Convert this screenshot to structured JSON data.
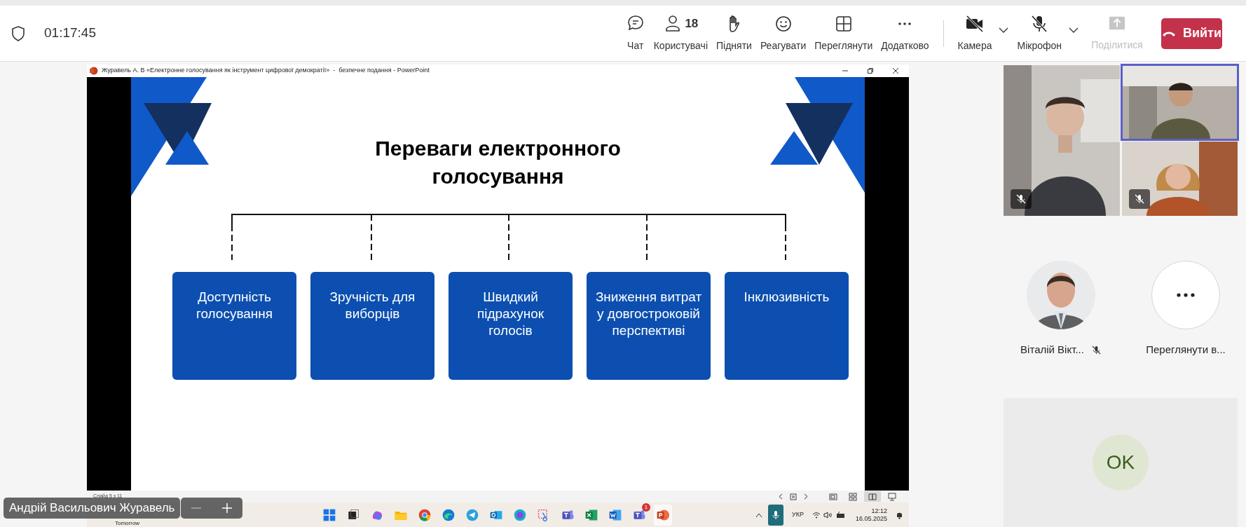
{
  "meeting_bar": {
    "timer": "01:17:45",
    "tools": [
      {
        "kind": "chat",
        "label": "Чат"
      },
      {
        "kind": "people",
        "label": "Користувачі",
        "count": "18"
      },
      {
        "kind": "raise",
        "label": "Підняти"
      },
      {
        "kind": "react",
        "label": "Реагувати"
      },
      {
        "kind": "view",
        "label": "Переглянути"
      },
      {
        "kind": "more",
        "label": "Додатково"
      }
    ],
    "devices": [
      {
        "kind": "camera",
        "label": "Камера",
        "on": false
      },
      {
        "kind": "mic",
        "label": "Мікрофон",
        "on": false
      }
    ],
    "share": {
      "label": "Поділитися",
      "disabled": true
    },
    "leave_button": "Вийти"
  },
  "shared_window": {
    "title": "Журавель А. В «Електронне голосування як інструмент цифрової демократії»  -  безпечне подання - PowerPoint",
    "slide": {
      "title": "Переваги електронного голосування",
      "boxes": [
        "Доступність голосування",
        "Зручність для виборців",
        "Швидкий підрахунок голосів",
        "Зниження витрат у довгостроковій перспективі",
        "Інклюзивність"
      ]
    },
    "status": "Слайд 5 з 11",
    "view_buttons": [
      {
        "kind": "normal",
        "selected": false
      },
      {
        "kind": "sorter",
        "selected": false
      },
      {
        "kind": "reading",
        "selected": true
      },
      {
        "kind": "slideshow",
        "selected": false
      }
    ]
  },
  "taskbar": {
    "widget_text": "Tomorrow",
    "apps": [
      {
        "kind": "start"
      },
      {
        "kind": "taskview"
      },
      {
        "kind": "copilot"
      },
      {
        "kind": "folder"
      },
      {
        "kind": "chrome"
      },
      {
        "kind": "edge"
      },
      {
        "kind": "telegram"
      },
      {
        "kind": "outlook"
      },
      {
        "kind": "canva"
      },
      {
        "kind": "snip"
      },
      {
        "kind": "teams"
      },
      {
        "kind": "excel"
      },
      {
        "kind": "word"
      },
      {
        "kind": "teams",
        "badge": "1"
      },
      {
        "kind": "powerpoint"
      }
    ],
    "language": "УКР",
    "time": "12:12",
    "date": "16.05.2025"
  },
  "presenter_label": "Андрій Васильович Журавель",
  "video_tiles": [
    {
      "muted": true,
      "speaking": false
    },
    {
      "muted": false,
      "speaking": true
    },
    {
      "muted": true,
      "speaking": false
    }
  ],
  "participants": [
    {
      "kind": "avatar",
      "name": "Віталій Вікт...",
      "muted": true
    },
    {
      "kind": "more",
      "name": "Переглянути в...",
      "muted": false
    }
  ],
  "reaction_tile": {
    "initials": "OK"
  }
}
